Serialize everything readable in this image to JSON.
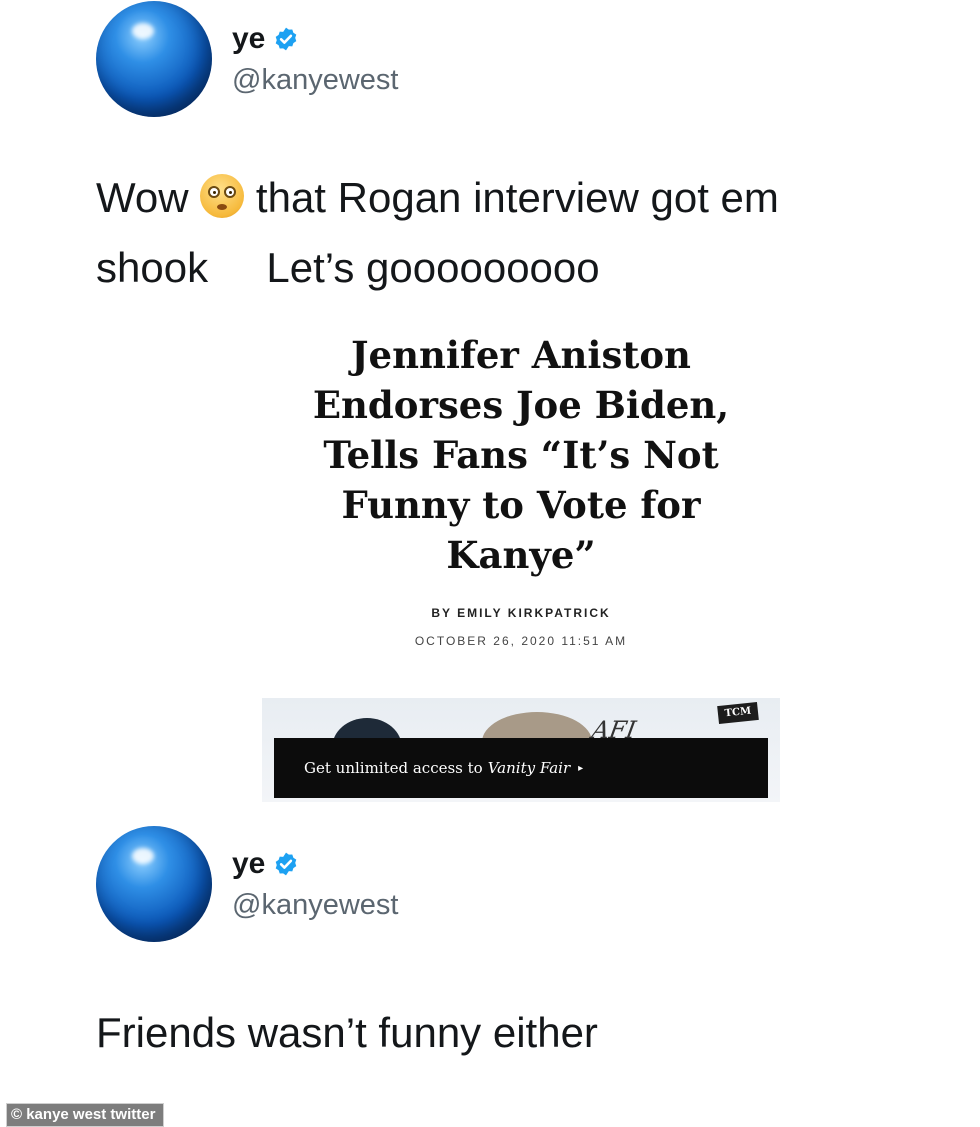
{
  "tweets": [
    {
      "display_name": "ye",
      "handle": "@kanyewest",
      "verified": true,
      "text_line1_before_emoji": "Wow",
      "emoji": "flushed-face",
      "text_line1_after_emoji": "that Rogan interview got em",
      "text_line2": "shook     Let’s gooooooooo"
    },
    {
      "display_name": "ye",
      "handle": "@kanyewest",
      "verified": true,
      "text": "Friends wasn’t funny either"
    }
  ],
  "article": {
    "headline": "Jennifer Aniston Endorses Joe Biden, Tells Fans “It’s Not Funny to Vote for Kanye”",
    "byline": "BY EMILY KIRKPATRICK",
    "date": "OCTOBER 26, 2020 11:51 AM",
    "paywall_prefix": "Get unlimited access to",
    "paywall_brand": "Vanity Fair",
    "paywall_arrow": "▸",
    "image_marks": {
      "afi": "AFI",
      "tcm": "TCM"
    }
  },
  "caption": "© kanye west twitter",
  "colors": {
    "verified_badge": "#1da1f2",
    "handle_gray": "#5b6670",
    "paywall_bg": "#0c0c0c"
  },
  "icons": {
    "avatar": "blue-sphere-avatar",
    "verified": "verified-badge-icon",
    "emoji": "flushed-face-emoji"
  }
}
